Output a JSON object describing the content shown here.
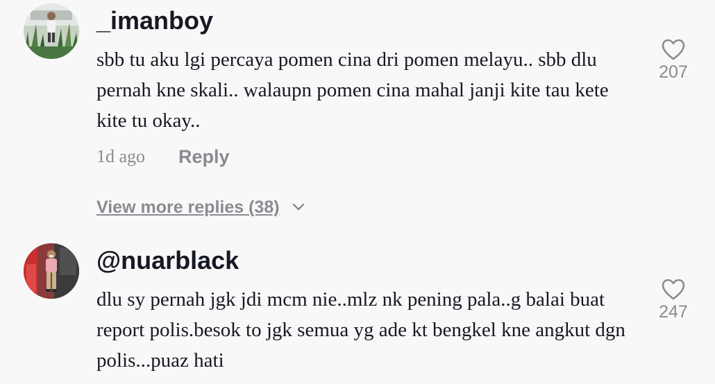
{
  "comments": [
    {
      "username": "_imanboy",
      "text": "sbb tu aku lgi percaya pomen cina dri pomen melayu.. sbb dlu pernah kne skali.. walaupn pomen cina mahal janji kite tau kete kite tu okay..",
      "time": "1d ago",
      "reply_label": "Reply",
      "likes": "207",
      "avatar_icon": "avatar-photo-plants",
      "view_more_replies": "View more replies (38)"
    },
    {
      "username": "@nuarblack",
      "text": "dlu sy pernah jgk jdi mcm nie..mlz nk pening pala..g balai buat report polis.besok to jgk semua yg ade kt bengkel kne angkut dgn polis...puaz hati",
      "likes": "247",
      "avatar_icon": "avatar-photo-person"
    }
  ],
  "icons": {
    "like": "heart-outline-icon",
    "expand": "chevron-down-icon"
  },
  "colors": {
    "background": "#f8f8f8",
    "primary_text": "#161823",
    "secondary_text": "#8a8b91"
  }
}
